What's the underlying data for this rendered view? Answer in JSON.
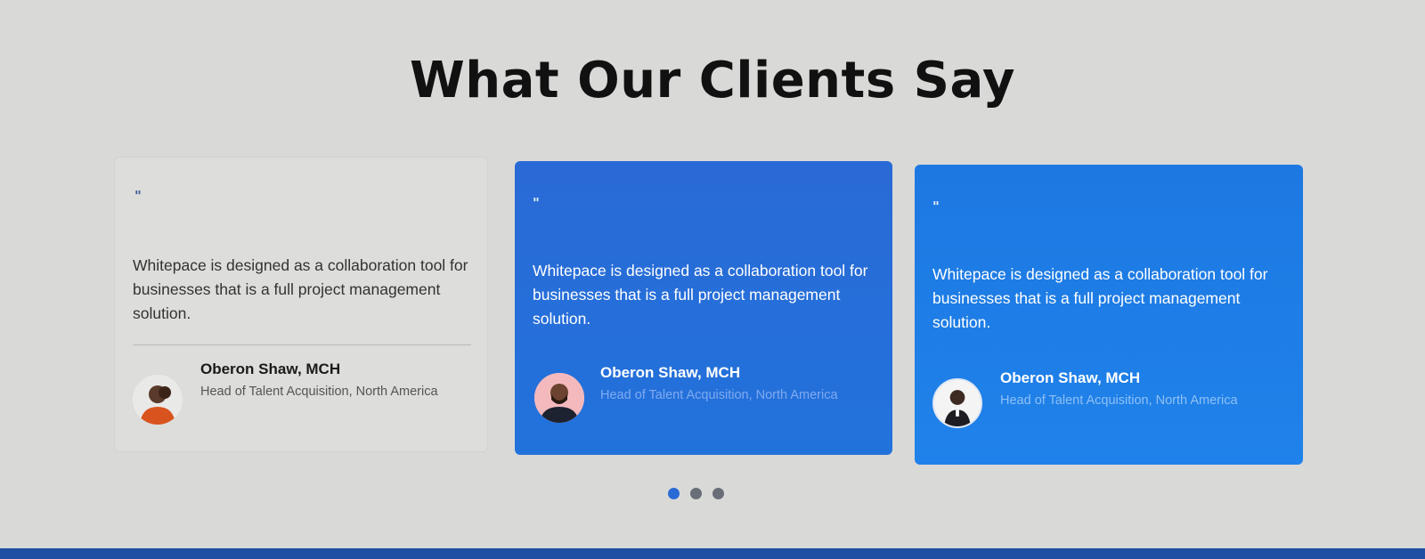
{
  "section": {
    "heading": "What Our Clients Say"
  },
  "testimonials": [
    {
      "quote_mark": "\"",
      "quote": "Whitepace is designed as a collaboration tool for businesses that is a full project management solution.",
      "name": "Oberon Shaw, MCH",
      "role": "Head of Talent Acquisition, North America"
    },
    {
      "quote_mark": "\"",
      "quote": "Whitepace is designed as a collaboration tool for businesses that is a full project management solution.",
      "name": "Oberon Shaw, MCH",
      "role": "Head of Talent Acquisition, North America"
    },
    {
      "quote_mark": "\"",
      "quote": "Whitepace is designed as a collaboration tool for businesses that is a full project management solution.",
      "name": "Oberon Shaw, MCH",
      "role": "Head of Talent Acquisition, North America"
    }
  ],
  "carousel": {
    "dot_count": 3,
    "active_index": 0
  },
  "colors": {
    "accent_blue": "#2a6ad6",
    "footer_blue": "#1f4fa3"
  }
}
